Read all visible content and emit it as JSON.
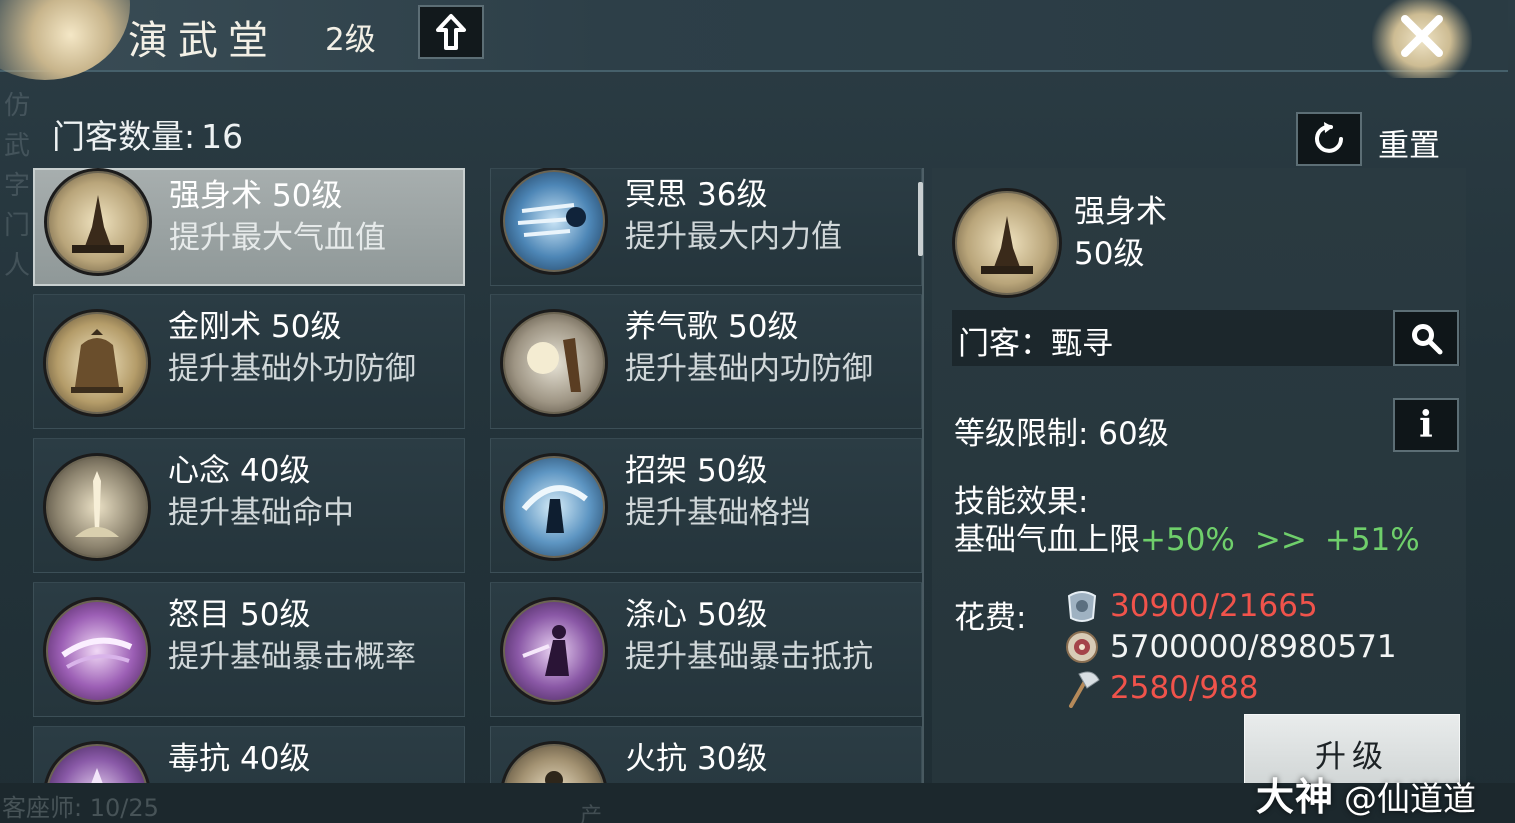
{
  "header": {
    "title": "演武堂",
    "level": "2级"
  },
  "disciples": {
    "label": "门客数量",
    "count": "16"
  },
  "left_deco": "仿武字门人",
  "skills": [
    {
      "name": "强身术",
      "level": "50级",
      "desc": "提升最大气血值",
      "icon": "palms-together-icon"
    },
    {
      "name": "冥思",
      "level": "36级",
      "desc": "提升最大内力值",
      "icon": "meditation-dash-icon"
    },
    {
      "name": "金刚术",
      "level": "50级",
      "desc": "提升基础外功防御",
      "icon": "bell-icon"
    },
    {
      "name": "养气歌",
      "level": "50级",
      "desc": "提升基础内功防御",
      "icon": "breath-tree-icon"
    },
    {
      "name": "心念",
      "level": "40级",
      "desc": "提升基础命中",
      "icon": "sword-pillar-icon"
    },
    {
      "name": "招架",
      "level": "50级",
      "desc": "提升基础格挡",
      "icon": "parry-icon"
    },
    {
      "name": "怒目",
      "level": "50级",
      "desc": "提升基础暴击概率",
      "icon": "purple-slash-icon"
    },
    {
      "name": "涤心",
      "level": "50级",
      "desc": "提升基础暴击抵抗",
      "icon": "purple-figure-icon"
    },
    {
      "name": "毒抗",
      "level": "40级",
      "desc": "",
      "icon": "poison-resist-icon"
    },
    {
      "name": "火抗",
      "level": "30级",
      "desc": "",
      "icon": "fire-resist-icon"
    }
  ],
  "reset": {
    "label": "重置"
  },
  "detail": {
    "name": "强身术",
    "level": "50级",
    "disciple_label": "门客：",
    "disciple_name": "甄寻",
    "level_limit": "等级限制: 60级",
    "effect_title": "技能效果:",
    "effect_stat": "基础气血上限",
    "effect_from": "+50%",
    "effect_arrow": ">>",
    "effect_to": "+51%",
    "cost_label": "花费:",
    "costs": [
      {
        "icon": "silver-coin-icon",
        "text": "30900/21665",
        "enough": false
      },
      {
        "icon": "gear-token-icon",
        "text": "5700000/8980571",
        "enough": true
      },
      {
        "icon": "axe-icon",
        "text": "2580/988",
        "enough": false
      }
    ],
    "upgrade_label": "升级"
  },
  "bottom": {
    "faded_left": "客座师: 10/25",
    "faded_mid": "产"
  },
  "watermark": {
    "brand": "大神",
    "handle": "@仙道道"
  },
  "colors": {
    "accent_green": "#6fcf6b",
    "insufficient_red": "#f0534b",
    "panel": "#2a3a41"
  }
}
